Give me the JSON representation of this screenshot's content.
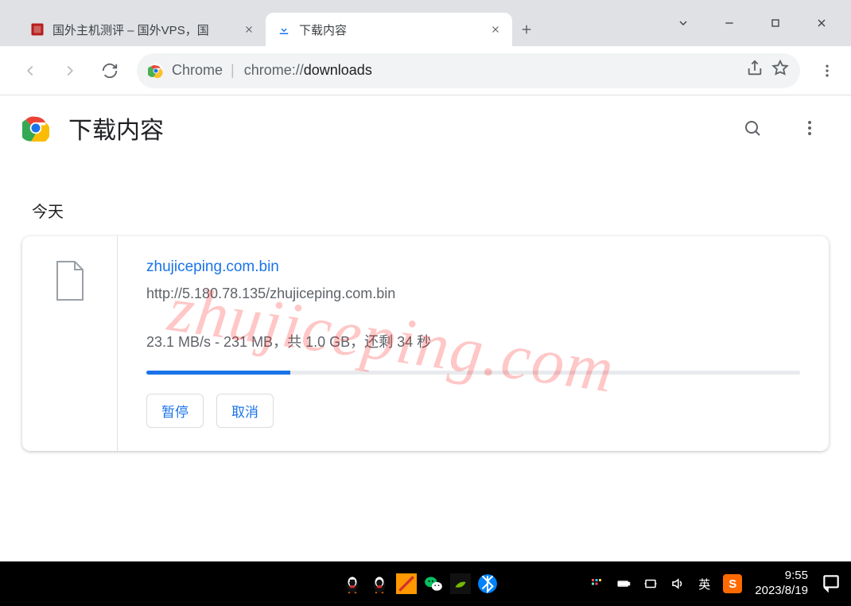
{
  "window": {
    "tabs": [
      {
        "title": "国外主机测评 – 国外VPS，国",
        "active": false
      },
      {
        "title": "下载内容",
        "active": true
      }
    ],
    "url_prefix": "chrome://",
    "url_highlight": "downloads",
    "site_chip_label": "Chrome"
  },
  "page": {
    "title": "下载内容",
    "section_today": "今天"
  },
  "download": {
    "filename": "zhujiceping.com.bin",
    "source_url": "http://5.180.78.135/zhujiceping.com.bin",
    "status_line": "23.1 MB/s - 231 MB，共 1.0 GB，还剩 34 秒",
    "progress_percent": 22,
    "pause_label": "暂停",
    "cancel_label": "取消"
  },
  "watermark": "zhujiceping.com",
  "taskbar": {
    "lang": "英",
    "ime": "S",
    "time": "9:55",
    "date": "2023/8/19"
  }
}
